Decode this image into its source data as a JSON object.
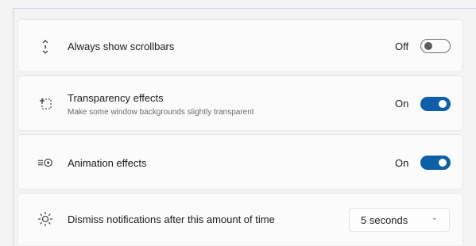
{
  "settings": [
    {
      "icon": "scrollbar-icon",
      "title": "Always show scrollbars",
      "state": "Off",
      "toggle": "off"
    },
    {
      "icon": "transparency-icon",
      "title": "Transparency effects",
      "description": "Make some window backgrounds slightly transparent",
      "state": "On",
      "toggle": "on"
    },
    {
      "icon": "animation-icon",
      "title": "Animation effects",
      "state": "On",
      "toggle": "on"
    },
    {
      "icon": "sun-icon",
      "title": "Dismiss notifications after this amount of time",
      "dropdown_value": "5 seconds"
    }
  ],
  "colors": {
    "accent": "#0e5ea8",
    "card": "#fbfbfb",
    "page": "#f3f3f3"
  }
}
